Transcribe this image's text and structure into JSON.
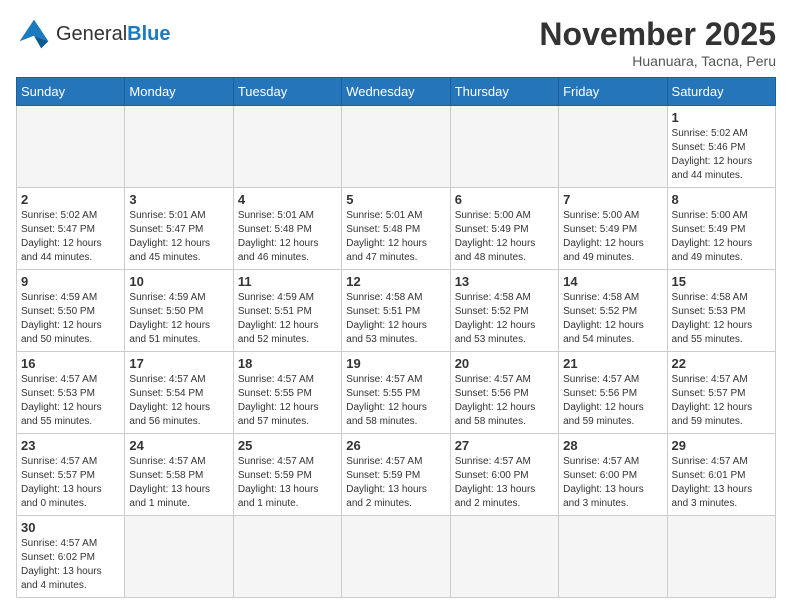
{
  "header": {
    "logo_general": "General",
    "logo_blue": "Blue",
    "month_title": "November 2025",
    "location": "Huanuara, Tacna, Peru"
  },
  "days_of_week": [
    "Sunday",
    "Monday",
    "Tuesday",
    "Wednesday",
    "Thursday",
    "Friday",
    "Saturday"
  ],
  "weeks": [
    [
      {
        "day": "",
        "info": ""
      },
      {
        "day": "",
        "info": ""
      },
      {
        "day": "",
        "info": ""
      },
      {
        "day": "",
        "info": ""
      },
      {
        "day": "",
        "info": ""
      },
      {
        "day": "",
        "info": ""
      },
      {
        "day": "1",
        "info": "Sunrise: 5:02 AM\nSunset: 5:46 PM\nDaylight: 12 hours\nand 44 minutes."
      }
    ],
    [
      {
        "day": "2",
        "info": "Sunrise: 5:02 AM\nSunset: 5:47 PM\nDaylight: 12 hours\nand 44 minutes."
      },
      {
        "day": "3",
        "info": "Sunrise: 5:01 AM\nSunset: 5:47 PM\nDaylight: 12 hours\nand 45 minutes."
      },
      {
        "day": "4",
        "info": "Sunrise: 5:01 AM\nSunset: 5:48 PM\nDaylight: 12 hours\nand 46 minutes."
      },
      {
        "day": "5",
        "info": "Sunrise: 5:01 AM\nSunset: 5:48 PM\nDaylight: 12 hours\nand 47 minutes."
      },
      {
        "day": "6",
        "info": "Sunrise: 5:00 AM\nSunset: 5:49 PM\nDaylight: 12 hours\nand 48 minutes."
      },
      {
        "day": "7",
        "info": "Sunrise: 5:00 AM\nSunset: 5:49 PM\nDaylight: 12 hours\nand 49 minutes."
      },
      {
        "day": "8",
        "info": "Sunrise: 5:00 AM\nSunset: 5:49 PM\nDaylight: 12 hours\nand 49 minutes."
      }
    ],
    [
      {
        "day": "9",
        "info": "Sunrise: 4:59 AM\nSunset: 5:50 PM\nDaylight: 12 hours\nand 50 minutes."
      },
      {
        "day": "10",
        "info": "Sunrise: 4:59 AM\nSunset: 5:50 PM\nDaylight: 12 hours\nand 51 minutes."
      },
      {
        "day": "11",
        "info": "Sunrise: 4:59 AM\nSunset: 5:51 PM\nDaylight: 12 hours\nand 52 minutes."
      },
      {
        "day": "12",
        "info": "Sunrise: 4:58 AM\nSunset: 5:51 PM\nDaylight: 12 hours\nand 53 minutes."
      },
      {
        "day": "13",
        "info": "Sunrise: 4:58 AM\nSunset: 5:52 PM\nDaylight: 12 hours\nand 53 minutes."
      },
      {
        "day": "14",
        "info": "Sunrise: 4:58 AM\nSunset: 5:52 PM\nDaylight: 12 hours\nand 54 minutes."
      },
      {
        "day": "15",
        "info": "Sunrise: 4:58 AM\nSunset: 5:53 PM\nDaylight: 12 hours\nand 55 minutes."
      }
    ],
    [
      {
        "day": "16",
        "info": "Sunrise: 4:57 AM\nSunset: 5:53 PM\nDaylight: 12 hours\nand 55 minutes."
      },
      {
        "day": "17",
        "info": "Sunrise: 4:57 AM\nSunset: 5:54 PM\nDaylight: 12 hours\nand 56 minutes."
      },
      {
        "day": "18",
        "info": "Sunrise: 4:57 AM\nSunset: 5:55 PM\nDaylight: 12 hours\nand 57 minutes."
      },
      {
        "day": "19",
        "info": "Sunrise: 4:57 AM\nSunset: 5:55 PM\nDaylight: 12 hours\nand 58 minutes."
      },
      {
        "day": "20",
        "info": "Sunrise: 4:57 AM\nSunset: 5:56 PM\nDaylight: 12 hours\nand 58 minutes."
      },
      {
        "day": "21",
        "info": "Sunrise: 4:57 AM\nSunset: 5:56 PM\nDaylight: 12 hours\nand 59 minutes."
      },
      {
        "day": "22",
        "info": "Sunrise: 4:57 AM\nSunset: 5:57 PM\nDaylight: 12 hours\nand 59 minutes."
      }
    ],
    [
      {
        "day": "23",
        "info": "Sunrise: 4:57 AM\nSunset: 5:57 PM\nDaylight: 13 hours\nand 0 minutes."
      },
      {
        "day": "24",
        "info": "Sunrise: 4:57 AM\nSunset: 5:58 PM\nDaylight: 13 hours\nand 1 minute."
      },
      {
        "day": "25",
        "info": "Sunrise: 4:57 AM\nSunset: 5:59 PM\nDaylight: 13 hours\nand 1 minute."
      },
      {
        "day": "26",
        "info": "Sunrise: 4:57 AM\nSunset: 5:59 PM\nDaylight: 13 hours\nand 2 minutes."
      },
      {
        "day": "27",
        "info": "Sunrise: 4:57 AM\nSunset: 6:00 PM\nDaylight: 13 hours\nand 2 minutes."
      },
      {
        "day": "28",
        "info": "Sunrise: 4:57 AM\nSunset: 6:00 PM\nDaylight: 13 hours\nand 3 minutes."
      },
      {
        "day": "29",
        "info": "Sunrise: 4:57 AM\nSunset: 6:01 PM\nDaylight: 13 hours\nand 3 minutes."
      }
    ],
    [
      {
        "day": "30",
        "info": "Sunrise: 4:57 AM\nSunset: 6:02 PM\nDaylight: 13 hours\nand 4 minutes."
      },
      {
        "day": "",
        "info": ""
      },
      {
        "day": "",
        "info": ""
      },
      {
        "day": "",
        "info": ""
      },
      {
        "day": "",
        "info": ""
      },
      {
        "day": "",
        "info": ""
      },
      {
        "day": "",
        "info": ""
      }
    ]
  ]
}
